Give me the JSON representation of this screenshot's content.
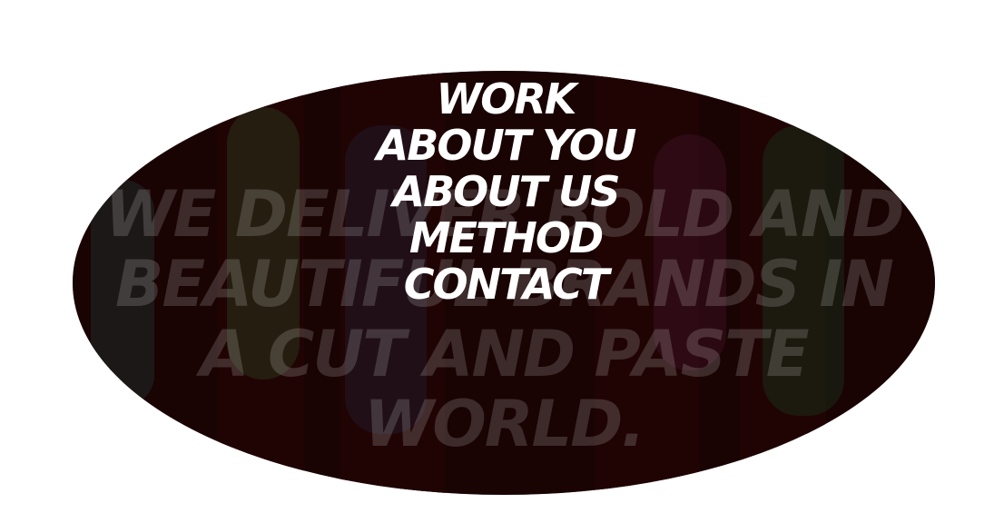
{
  "hero": {
    "tagline_lines": [
      "WE DELIVER BOLD AND",
      "BEAUTIFUL BRANDS IN",
      "A CUT AND PASTE",
      "WORLD."
    ],
    "background_image": "dancers-photo"
  },
  "nav": {
    "items": [
      {
        "label": "WORK"
      },
      {
        "label": "ABOUT YOU"
      },
      {
        "label": "ABOUT US"
      },
      {
        "label": "METHOD"
      },
      {
        "label": "CONTACT"
      }
    ]
  },
  "colors": {
    "overlay": "#1e0505",
    "menu_text": "#ffffff",
    "page_background": "#ffffff"
  }
}
